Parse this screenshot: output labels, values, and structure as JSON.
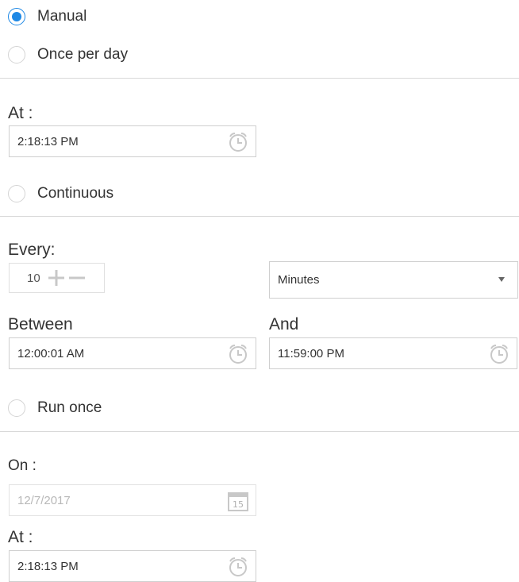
{
  "schedule": {
    "manual_label": "Manual",
    "once_per_day_label": "Once per day",
    "continuous_label": "Continuous",
    "run_once_label": "Run once",
    "selected": "Manual"
  },
  "once_per_day": {
    "at_label": "At :",
    "at_time": "2:18:13 PM"
  },
  "continuous": {
    "every_label": "Every:",
    "every_value": "10",
    "unit_value": "Minutes",
    "between_label": "Between",
    "between_time": "12:00:01 AM",
    "and_label": "And",
    "and_time": "11:59:00 PM"
  },
  "run_once": {
    "on_label": "On :",
    "on_date": "12/7/2017",
    "calendar_day": "15",
    "at_label": "At :",
    "at_time": "2:18:13 PM"
  },
  "colors": {
    "accent": "#1e88e5",
    "border": "#cfcfcf",
    "divider": "#d9d9d9",
    "icon": "#c8c8c8"
  },
  "icons": {
    "clock": "alarm-clock-icon",
    "calendar": "calendar-icon",
    "plus": "plus-icon",
    "minus": "minus-icon",
    "caret": "caret-down-icon"
  }
}
